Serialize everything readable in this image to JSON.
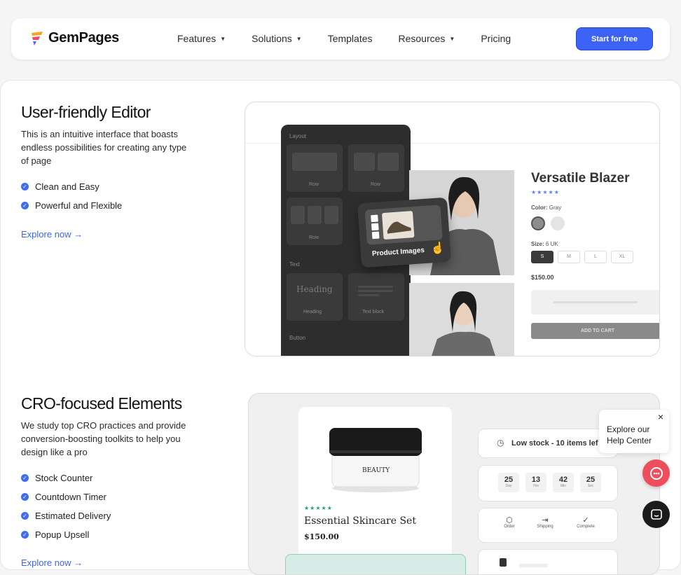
{
  "nav": {
    "brand": "GemPages",
    "items": [
      {
        "label": "Features",
        "dropdown": true
      },
      {
        "label": "Solutions",
        "dropdown": true
      },
      {
        "label": "Templates",
        "dropdown": false
      },
      {
        "label": "Resources",
        "dropdown": true
      },
      {
        "label": "Pricing",
        "dropdown": false
      }
    ],
    "cta": "Start for free"
  },
  "section1": {
    "title": "User-friendly Editor",
    "desc": "This is an intuitive interface that boasts endless possibilities for creating any type of page",
    "features": [
      "Clean and Easy",
      "Powerful and Flexible"
    ],
    "explore": "Explore now →"
  },
  "editor": {
    "layout_label": "Layout",
    "row_label": "Row",
    "text_label": "Text",
    "heading_preview": "Heading",
    "heading_label": "Heading",
    "textblock_label": "Text block",
    "button_label": "Button",
    "drag_label": "Product Images"
  },
  "product": {
    "name": "Versatile Blazer",
    "stars": "★★★★★",
    "color_label": "Color:",
    "color_value": "Gray",
    "size_label": "Size:",
    "size_value": "6 UK",
    "sizes": [
      "S",
      "M",
      "L",
      "XL"
    ],
    "price": "$150.00",
    "add_to_cart": "ADD TO CART"
  },
  "section2": {
    "title": "CRO-focused Elements",
    "desc": "We study top CRO practices and provide conversion-boosting toolkits to help you design like a pro",
    "features": [
      "Stock Counter",
      "Countdown Timer",
      "Estimated Delivery",
      "Popup Upsell"
    ],
    "explore": "Explore now →"
  },
  "skincare": {
    "jar_brand": "BEAUTY",
    "stars": "★★★★★",
    "name": "Essential Skincare Set",
    "price": "$150.00"
  },
  "cro": {
    "stock_text": "Low stock - 10 items lef",
    "timer": [
      {
        "value": "25",
        "unit": "Day"
      },
      {
        "value": "13",
        "unit": "Hrs"
      },
      {
        "value": "42",
        "unit": "Min"
      },
      {
        "value": "25",
        "unit": "Sec"
      }
    ],
    "delivery_steps": [
      "Order",
      "Shipping",
      "Complete"
    ]
  },
  "help": {
    "tip": "Explore our Help Center"
  },
  "colors": {
    "accent": "#3c63f5",
    "check": "#3e6bf1",
    "dark_panel": "#2d2d2d",
    "help_badge": "#ec4e5c",
    "star_blue": "#5b7ff0",
    "star_green": "#1f9d7a"
  }
}
